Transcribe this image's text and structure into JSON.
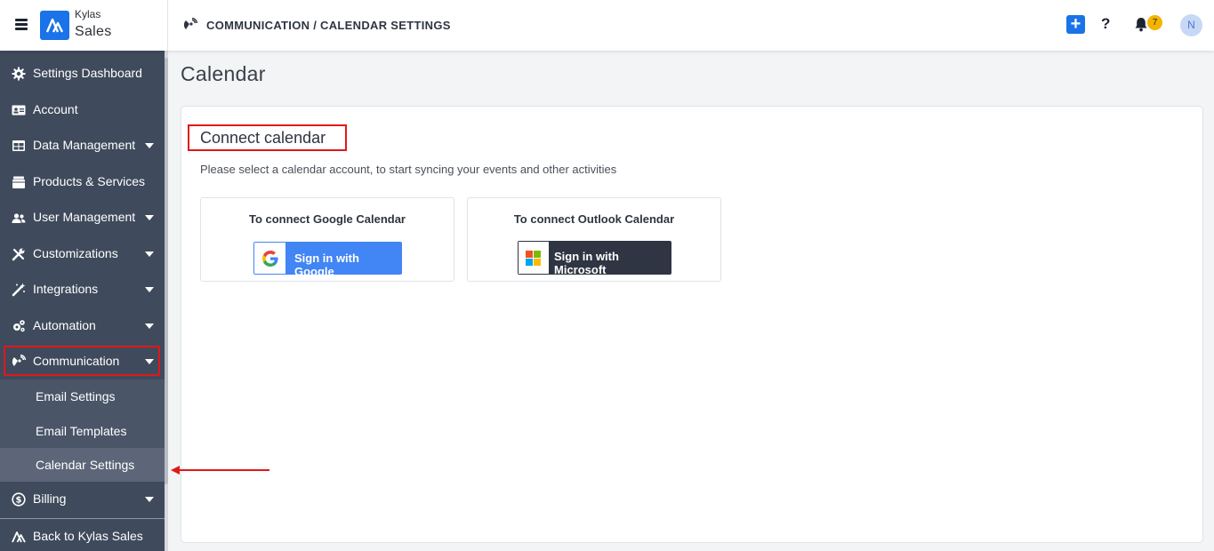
{
  "header": {
    "brand_top": "Kylas",
    "brand_bottom": "Sales",
    "breadcrumb": "COMMUNICATION / CALENDAR SETTINGS",
    "add_icon": "plus-icon",
    "add_label": "+",
    "help_label": "?",
    "notifications_count": "7",
    "avatar_initial": "N"
  },
  "sidebar": {
    "items": [
      {
        "label": "Settings Dashboard",
        "icon": "gear-icon",
        "has_caret": false
      },
      {
        "label": "Account",
        "icon": "id-card-icon",
        "has_caret": false
      },
      {
        "label": "Data Management",
        "icon": "table-icon",
        "has_caret": true
      },
      {
        "label": "Products & Services",
        "icon": "box-icon",
        "has_caret": false
      },
      {
        "label": "User Management",
        "icon": "users-icon",
        "has_caret": true
      },
      {
        "label": "Customizations",
        "icon": "tools-icon",
        "has_caret": true
      },
      {
        "label": "Integrations",
        "icon": "magic-wand-icon",
        "has_caret": true
      },
      {
        "label": "Automation",
        "icon": "cogs-icon",
        "has_caret": true
      },
      {
        "label": "Communication",
        "icon": "satellite-icon",
        "has_caret": true
      },
      {
        "label": "Billing",
        "icon": "dollar-circle-icon",
        "has_caret": true
      }
    ],
    "sub_items": [
      {
        "label": "Email Settings"
      },
      {
        "label": "Email Templates"
      },
      {
        "label": "Calendar Settings",
        "active": true
      }
    ],
    "back_label": "Back to Kylas Sales"
  },
  "main": {
    "title": "Calendar",
    "connect_title": "Connect calendar",
    "connect_subtitle": "Please select a calendar account, to start syncing your events and other activities",
    "google": {
      "title": "To connect Google Calendar",
      "button_label": "Sign in with Google"
    },
    "outlook": {
      "title": "To connect Outlook Calendar",
      "button_label": "Sign in with Microsoft"
    }
  },
  "colors": {
    "accent": "#1a73e8",
    "sidebar_bg": "#3f4a5c",
    "highlight": "#e01818",
    "google_blue": "#4285f4",
    "ms_dark": "#2f3542"
  }
}
